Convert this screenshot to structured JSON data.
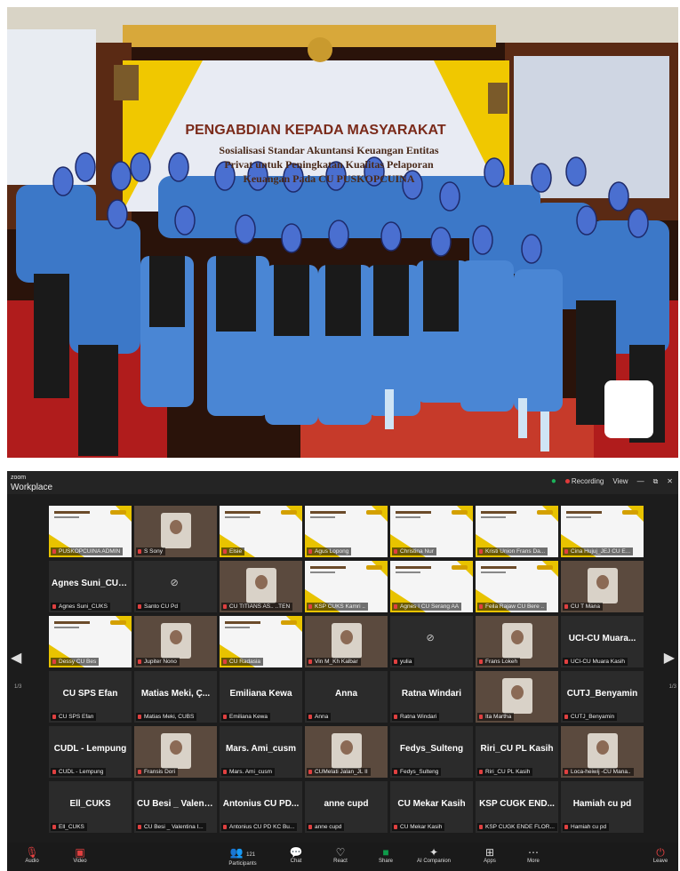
{
  "app": {
    "title": "zoom",
    "subtitle": "Workplace"
  },
  "titlebar": {
    "recording": "Recording",
    "view": "View",
    "minimize": "—",
    "restore": "⧉",
    "close": "✕"
  },
  "banner": {
    "title": "PENGABDIAN KEPADA MASYARAKAT",
    "subtitle1": "Sosialisasi Standar Akuntansi Keuangan Entitas",
    "subtitle2": "Privat untuk Peningkatan Kualitas Pelaporan",
    "subtitle3": "Keuangan Pada CU PUSKOPCUINA"
  },
  "tiles": [
    {
      "name": "",
      "label": "PUSKOPCUINA ADMIN",
      "kind": "slide"
    },
    {
      "name": "",
      "label": "S Sony",
      "kind": "cam"
    },
    {
      "name": "",
      "label": "Elsie",
      "kind": "slide"
    },
    {
      "name": "",
      "label": "Agus Lopong",
      "kind": "slide"
    },
    {
      "name": "",
      "label": "Christina Nur",
      "kind": "slide"
    },
    {
      "name": "",
      "label": "Kristi Union Frans Da...",
      "kind": "slide"
    },
    {
      "name": "",
      "label": "Cina Hujuj_JEJ CU E...",
      "kind": "slide"
    },
    {
      "name": "Agnes Suni_CUKS",
      "label": "Agnes Suni_CUKS",
      "kind": "name"
    },
    {
      "name": "",
      "label": "Santo CU Pd",
      "kind": "off"
    },
    {
      "name": "",
      "label": "CU TITIANS AS.. ..TEN",
      "kind": "cam"
    },
    {
      "name": "",
      "label": "KSP CUKS Kamri ..",
      "kind": "slide"
    },
    {
      "name": "",
      "label": "Agnes I CU Serang AA",
      "kind": "slide"
    },
    {
      "name": "",
      "label": "Feila Rajaw CU Bere ..",
      "kind": "slide"
    },
    {
      "name": "",
      "label": "CU T Mana",
      "kind": "cam"
    },
    {
      "name": "",
      "label": "Dessy CU Bes",
      "kind": "slide"
    },
    {
      "name": "",
      "label": "Jupiter Nono",
      "kind": "cam"
    },
    {
      "name": "",
      "label": "CU Radasia",
      "kind": "slide"
    },
    {
      "name": "",
      "label": "Vin M_Kh Kalbar",
      "kind": "cam"
    },
    {
      "name": "",
      "label": "yulia",
      "kind": "off"
    },
    {
      "name": "",
      "label": "Frans Lokeh",
      "kind": "cam"
    },
    {
      "name": "UCI-CU Muara...",
      "label": "UCI-CU Muara Kasih",
      "kind": "name"
    },
    {
      "name": "CU SPS Efan",
      "label": "CU SPS Efan",
      "kind": "name"
    },
    {
      "name": "Matias Meki, Ç...",
      "label": "Matias Meki, CUBS",
      "kind": "name"
    },
    {
      "name": "Emiliana Kewa",
      "label": "Emiliana Kewa",
      "kind": "name"
    },
    {
      "name": "Anna",
      "label": "Anna",
      "kind": "name"
    },
    {
      "name": "Ratna Windari",
      "label": "Ratna Windari",
      "kind": "name"
    },
    {
      "name": "",
      "label": "Ita Martha",
      "kind": "cam"
    },
    {
      "name": "CUTJ_Benyamin",
      "label": "CUTJ_Benyamin",
      "kind": "name"
    },
    {
      "name": "CUDL - Lempung",
      "label": "CUDL - Lempung",
      "kind": "name"
    },
    {
      "name": "",
      "label": "Fransis Dori",
      "kind": "cam"
    },
    {
      "name": "Mars. Ami_cusm",
      "label": "Mars. Ami_cusm",
      "kind": "name"
    },
    {
      "name": "",
      "label": "CUMelati Jalan_JL II",
      "kind": "cam"
    },
    {
      "name": "Fedys_Sulteng",
      "label": "Fedys_Sulteng",
      "kind": "name"
    },
    {
      "name": "Riri_CU PL Kasih",
      "label": "Riri_CU PL Kasih",
      "kind": "name"
    },
    {
      "name": "",
      "label": "Loca-heiwij -CU Mana..",
      "kind": "cam"
    },
    {
      "name": "Ell_CUKS",
      "label": "Ell_CUKS",
      "kind": "name"
    },
    {
      "name": "CU Besi _ Valent...",
      "label": "CU Besi _ Valentina I...",
      "kind": "name"
    },
    {
      "name": "Antonius CU PD...",
      "label": "Antonius CU PD KC Bu...",
      "kind": "name"
    },
    {
      "name": "anne cupd",
      "label": "anne cupd",
      "kind": "name"
    },
    {
      "name": "CU Mekar Kasih",
      "label": "CU Mekar Kasih",
      "kind": "name"
    },
    {
      "name": "KSP CUGK END...",
      "label": "KSP CUGK ENDE FLOR...",
      "kind": "name"
    },
    {
      "name": "Hamiah cu pd",
      "label": "Hamiah cu pd",
      "kind": "name"
    }
  ],
  "nav": {
    "prev": "◀",
    "next": "▶",
    "page_left": "1/3",
    "page_right": "1/3"
  },
  "toolbar": {
    "audio": "Audio",
    "video": "Video",
    "participants": "Participants",
    "participants_count": "121",
    "chat": "Chat",
    "react": "React",
    "share": "Share",
    "ai": "AI Companion",
    "apps": "Apps",
    "more": "More",
    "leave": "Leave"
  }
}
